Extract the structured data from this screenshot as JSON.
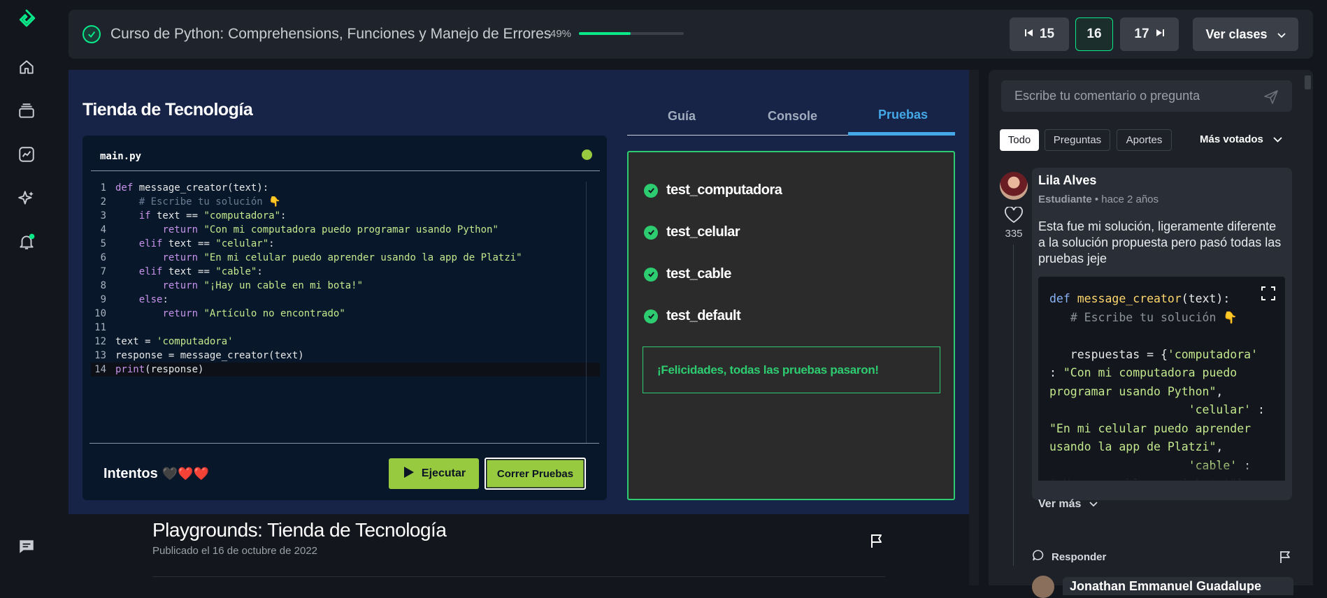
{
  "header": {
    "course_title": "Curso de Python: Comprehensions, Funciones y Manejo de Errores",
    "progress_label": "49%",
    "progress": 0.49,
    "prev_class": "15",
    "current_class": "16",
    "next_class": "17",
    "ver_clases": "Ver clases"
  },
  "playground": {
    "title": "Tienda de Tecnología",
    "file_name": "main.py",
    "code_lines": [
      {
        "n": "1",
        "html": "<span class='kw'>def</span> message_creator(text):"
      },
      {
        "n": "2",
        "html": "    <span class='cmt'># Escribe tu solución 👇</span>"
      },
      {
        "n": "3",
        "html": "    <span class='kw'>if</span> text == <span class='str'>\"computadora\"</span>:"
      },
      {
        "n": "4",
        "html": "        <span class='kw'>return</span> <span class='str'>\"Con mi computadora puedo programar usando Python\"</span>"
      },
      {
        "n": "5",
        "html": "    <span class='kw'>elif</span> text == <span class='str'>\"celular\"</span>:"
      },
      {
        "n": "6",
        "html": "        <span class='kw'>return</span> <span class='str'>\"En mi celular puedo aprender usando la app de Platzi\"</span>"
      },
      {
        "n": "7",
        "html": "    <span class='kw'>elif</span> text == <span class='str'>\"cable\"</span>:"
      },
      {
        "n": "8",
        "html": "        <span class='kw'>return</span> <span class='str'>\"¡Hay un cable en mi bota!\"</span>"
      },
      {
        "n": "9",
        "html": "    <span class='kw'>else</span>:"
      },
      {
        "n": "10",
        "html": "        <span class='kw'>return</span> <span class='str'>\"Artículo no encontrado\"</span>"
      },
      {
        "n": "11",
        "html": ""
      },
      {
        "n": "12",
        "html": "text = <span class='str'>'computadora'</span>"
      },
      {
        "n": "13",
        "html": "response = message_creator(text)"
      },
      {
        "n": "14",
        "html": "<span class='kw'>print</span>(response)"
      }
    ],
    "intentos_label": "Intentos",
    "hearts": [
      "🖤",
      "❤️",
      "❤️"
    ],
    "run_button": "Ejecutar",
    "tests_button": "Correr Pruebas",
    "tabs": [
      "Guía",
      "Console",
      "Pruebas"
    ],
    "active_tab": "Pruebas",
    "tests": [
      "test_computadora",
      "test_celular",
      "test_cable",
      "test_default"
    ],
    "success_message": "¡Felicidades, todas las pruebas pasaron!"
  },
  "article": {
    "title": "Playgrounds: Tienda de Tecnología",
    "date": "Publicado el 16 de octubre de 2022"
  },
  "comments": {
    "input_placeholder": "Escribe tu comentario o pregunta",
    "filters": [
      "Todo",
      "Preguntas",
      "Aportes"
    ],
    "active_filter": "Todo",
    "sort": "Más votados",
    "first": {
      "author": "Lila Alves",
      "role": "Estudiante",
      "time": "hace 2 años",
      "likes": "335",
      "text": "Esta fue mi solución, ligeramente diferente a la solución propuesta pero pasó todas las pruebas jeje",
      "code_html": "<span class='k'>def</span> <span class='f'>message_creator</span>(text):\n   <span class='c'># Escribe tu solución 👇</span>\n\n   respuestas = {<span class='s'>'computadora'</span>\n: <span class='s'>\"Con mi computadora puedo</span>\n<span class='s'>programar usando Python\"</span>,\n                    <span class='s'>'celular'</span> :\n<span class='s'>\"En mi celular puedo aprender</span>\n<span class='s'>usando la app de Platzi\"</span>,\n                    <span class='s'>'cable'</span> :\n<span class='s'>\"¡Hay un cable en mi bota!\"</span>},",
      "ver_mas": "Ver más",
      "reply": "Responder"
    },
    "next_author": "Jonathan Emmanuel Guadalupe"
  },
  "colors": {
    "accent": "#0ae98a",
    "run": "#98ca3f",
    "success": "#2ecc71",
    "tab_active": "#44a8e7"
  }
}
